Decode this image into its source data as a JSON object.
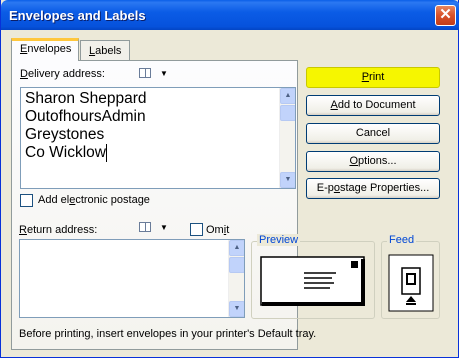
{
  "window": {
    "title": "Envelopes and Labels",
    "close_glyph": "✕"
  },
  "tabs": [
    {
      "label_ul": "E",
      "label_rest": "nvelopes"
    },
    {
      "label_ul": "L",
      "label_rest": "abels"
    }
  ],
  "delivery": {
    "label_ul": "D",
    "label_rest": "elivery address:",
    "lines": [
      "Sharon Sheppard",
      "OutofhoursAdmin",
      "Greystones",
      "Co Wicklow"
    ]
  },
  "postage": {
    "label_pre": "Add el",
    "label_ul": "e",
    "label_post": "ctronic postage"
  },
  "return": {
    "label_ul": "R",
    "label_rest": "eturn address:",
    "omit_pre": "Om",
    "omit_ul": "i",
    "omit_post": "t"
  },
  "buttons": {
    "print": {
      "ul": "P",
      "rest": "rint"
    },
    "add": {
      "ul": "A",
      "rest": "dd to Document"
    },
    "cancel": "Cancel",
    "options": {
      "ul": "O",
      "rest": "ptions..."
    },
    "epostage": {
      "pre": "E-p",
      "ul": "o",
      "rest": "stage Properties..."
    }
  },
  "preview": {
    "title": "Preview"
  },
  "feed": {
    "title": "Feed"
  },
  "footer": {
    "text": "Before printing, insert envelopes in your printer's Default tray."
  },
  "colors": {
    "title_bar": "#0553dc",
    "highlight": "#f6f600",
    "group_title": "#0046d5"
  }
}
